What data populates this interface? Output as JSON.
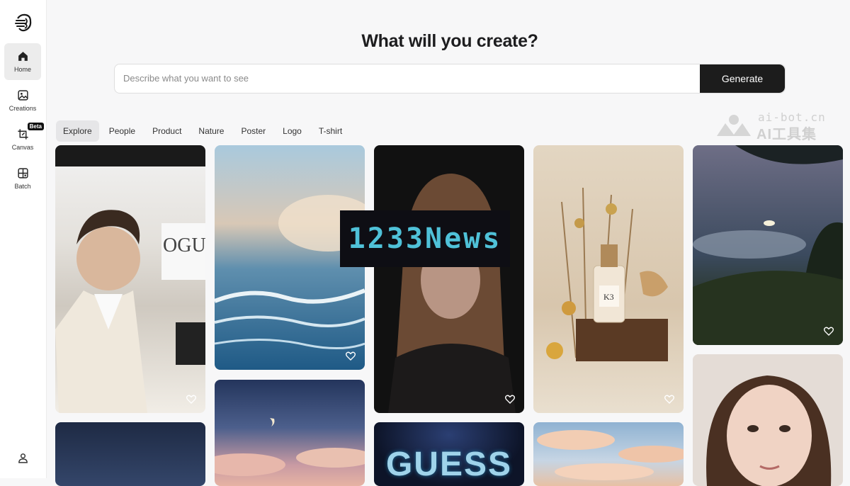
{
  "sidebar": {
    "items": [
      {
        "label": "Home",
        "icon": "home-icon",
        "active": true
      },
      {
        "label": "Creations",
        "icon": "image-icon",
        "active": false
      },
      {
        "label": "Canvas",
        "icon": "canvas-icon",
        "active": false,
        "badge": "Beta"
      },
      {
        "label": "Batch",
        "icon": "grid-icon",
        "active": false
      }
    ],
    "user_icon": "user-icon"
  },
  "header": {
    "title": "What will you create?",
    "search_placeholder": "Describe what you want to see",
    "search_value": "",
    "generate_label": "Generate"
  },
  "tabs": [
    {
      "label": "Explore",
      "active": true
    },
    {
      "label": "People",
      "active": false
    },
    {
      "label": "Product",
      "active": false
    },
    {
      "label": "Nature",
      "active": false
    },
    {
      "label": "Poster",
      "active": false
    },
    {
      "label": "Logo",
      "active": false
    },
    {
      "label": "T-shirt",
      "active": false
    }
  ],
  "watermark": {
    "top": "ai-bot.cn",
    "bottom": "AI工具集"
  },
  "overlay_text": "1233News",
  "gallery": {
    "poster_text": "GUESS"
  }
}
